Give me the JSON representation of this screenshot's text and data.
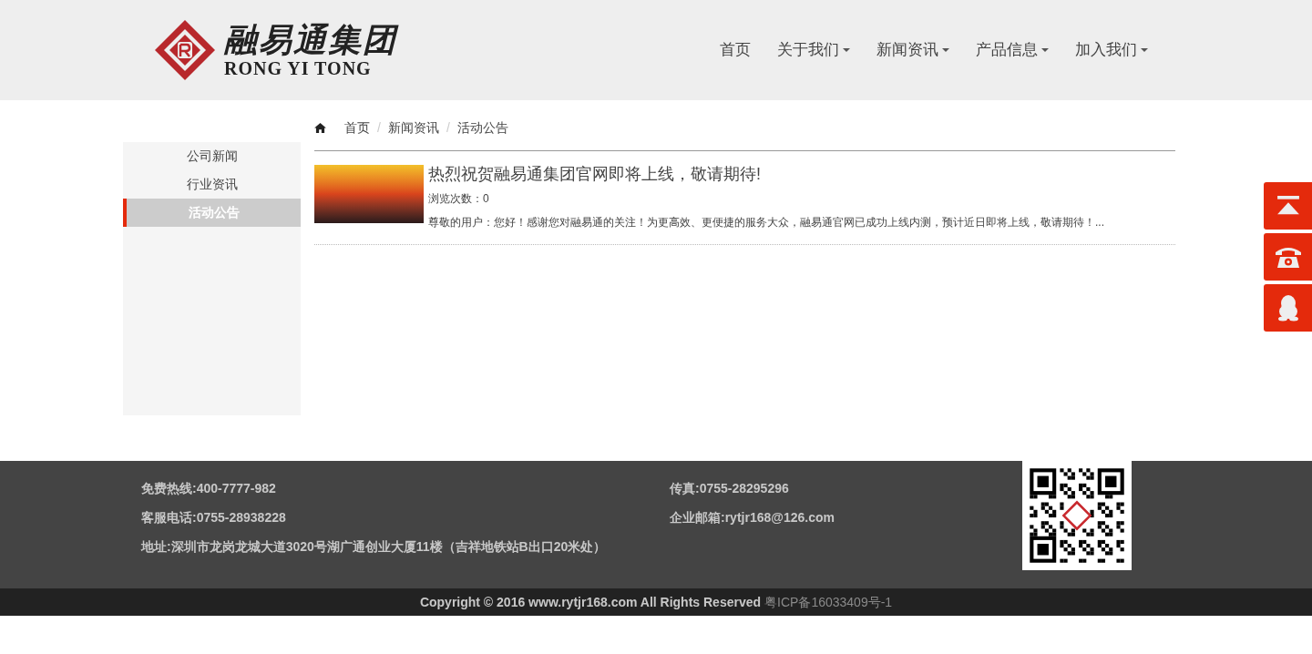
{
  "logo": {
    "title": "融易通集团",
    "subtitle": "RONG YI TONG"
  },
  "nav": [
    {
      "label": "首页",
      "dropdown": false
    },
    {
      "label": "关于我们",
      "dropdown": true
    },
    {
      "label": "新闻资讯",
      "dropdown": true
    },
    {
      "label": "产品信息",
      "dropdown": true
    },
    {
      "label": "加入我们",
      "dropdown": true
    }
  ],
  "breadcrumb": [
    {
      "label": "首页"
    },
    {
      "separator": "/",
      "label": "新闻资讯"
    },
    {
      "separator": "/",
      "label": "活动公告"
    }
  ],
  "sidebar": {
    "items": [
      {
        "label": "公司新闻",
        "selected": false
      },
      {
        "label": "行业资讯",
        "selected": false
      },
      {
        "label": "活动公告",
        "selected": true
      }
    ]
  },
  "articles": [
    {
      "title": "热烈祝贺融易通集团官网即将上线，敬请期待!",
      "views": "浏览次数：0",
      "summary": "尊敬的用户：您好！感谢您对融易通的关注！为更高效、更便捷的服务大众，融易通官网已成功上线内测，预计近日即将上线，敬请期待！..."
    }
  ],
  "footer": {
    "left": [
      "免费热线:400-7777-982",
      "客服电话:0755-28938228",
      "地址:深圳市龙岗龙城大道3020号湖广通创业大厦11楼（吉祥地铁站B出口20米处）"
    ],
    "right": [
      "传真:0755-28295296",
      "企业邮箱:rytjr168@126.com"
    ],
    "copyright": "Copyright © 2016 www.rytjr168.com All Rights Reserved",
    "icp": "粤ICP备16033409号-1"
  },
  "float_buttons": [
    {
      "kind": "top"
    },
    {
      "kind": "phone"
    },
    {
      "kind": "qq"
    }
  ]
}
